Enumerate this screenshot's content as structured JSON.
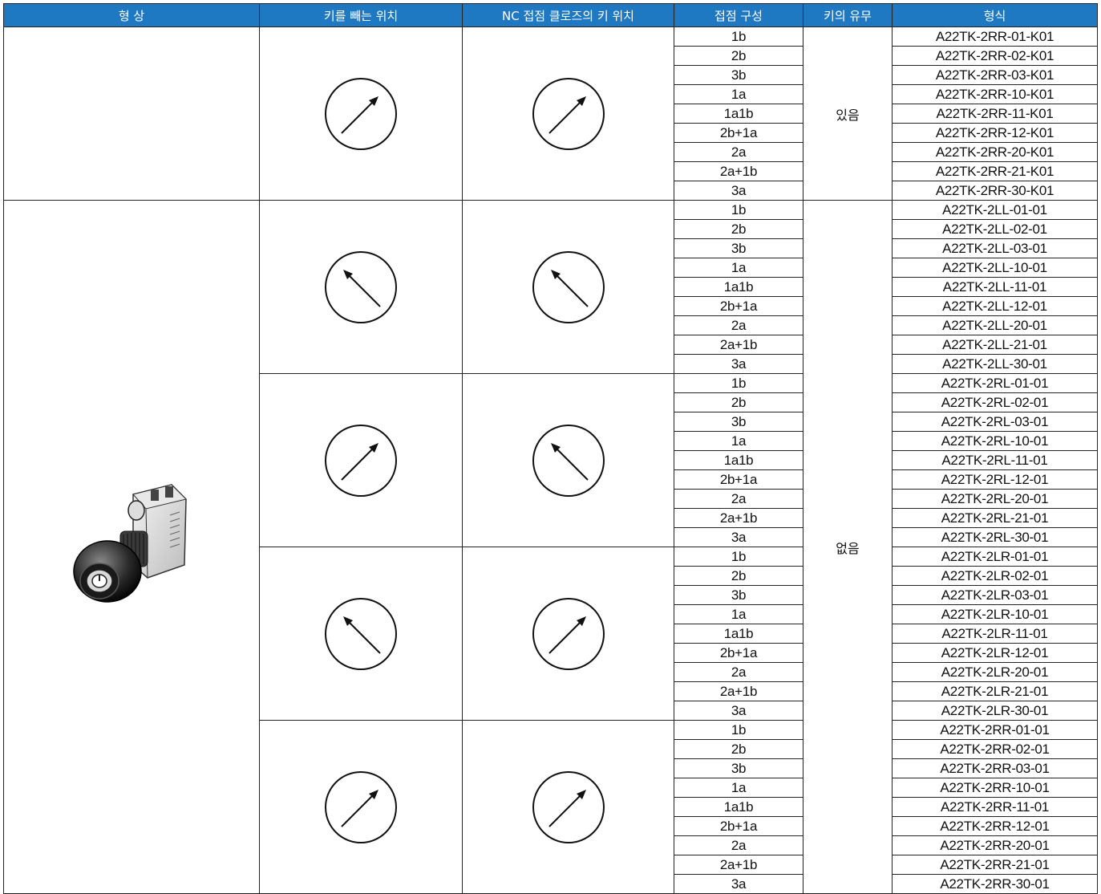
{
  "headers": [
    "형 상",
    "키를 빼는 위치",
    "NC 접점 클로즈의 키 위치",
    "접점 구성",
    "키의 유무",
    "형식"
  ],
  "contacts": [
    "1b",
    "2b",
    "3b",
    "1a",
    "1a1b",
    "2b+1a",
    "2a",
    "2a+1b",
    "3a"
  ],
  "groups": [
    {
      "removal_icon": "right-arrow-dial-icon",
      "nc_icon": "right-arrow-dial-icon",
      "models": [
        "A22TK-2RR-01-K01",
        "A22TK-2RR-02-K01",
        "A22TK-2RR-03-K01",
        "A22TK-2RR-10-K01",
        "A22TK-2RR-11-K01",
        "A22TK-2RR-12-K01",
        "A22TK-2RR-20-K01",
        "A22TK-2RR-21-K01",
        "A22TK-2RR-30-K01"
      ]
    },
    {
      "removal_icon": "left-arrow-dial-icon",
      "nc_icon": "left-arrow-dial-icon",
      "models": [
        "A22TK-2LL-01-01",
        "A22TK-2LL-02-01",
        "A22TK-2LL-03-01",
        "A22TK-2LL-10-01",
        "A22TK-2LL-11-01",
        "A22TK-2LL-12-01",
        "A22TK-2LL-20-01",
        "A22TK-2LL-21-01",
        "A22TK-2LL-30-01"
      ]
    },
    {
      "removal_icon": "right-arrow-dial-icon",
      "nc_icon": "left-arrow-dial-icon",
      "models": [
        "A22TK-2RL-01-01",
        "A22TK-2RL-02-01",
        "A22TK-2RL-03-01",
        "A22TK-2RL-10-01",
        "A22TK-2RL-11-01",
        "A22TK-2RL-12-01",
        "A22TK-2RL-20-01",
        "A22TK-2RL-21-01",
        "A22TK-2RL-30-01"
      ]
    },
    {
      "removal_icon": "left-arrow-dial-icon",
      "nc_icon": "right-arrow-dial-icon",
      "models": [
        "A22TK-2LR-01-01",
        "A22TK-2LR-02-01",
        "A22TK-2LR-03-01",
        "A22TK-2LR-10-01",
        "A22TK-2LR-11-01",
        "A22TK-2LR-12-01",
        "A22TK-2LR-20-01",
        "A22TK-2LR-21-01",
        "A22TK-2LR-30-01"
      ]
    },
    {
      "removal_icon": "right-arrow-dial-icon",
      "nc_icon": "right-arrow-dial-icon",
      "models": [
        "A22TK-2RR-01-01",
        "A22TK-2RR-02-01",
        "A22TK-2RR-03-01",
        "A22TK-2RR-10-01",
        "A22TK-2RR-11-01",
        "A22TK-2RR-12-01",
        "A22TK-2RR-20-01",
        "A22TK-2RR-21-01",
        "A22TK-2RR-30-01"
      ]
    }
  ],
  "key_presence": [
    "있음",
    "없음"
  ],
  "colors": {
    "header_bg": "#1e78c2",
    "header_text": "#ffffff",
    "border": "#222222"
  }
}
